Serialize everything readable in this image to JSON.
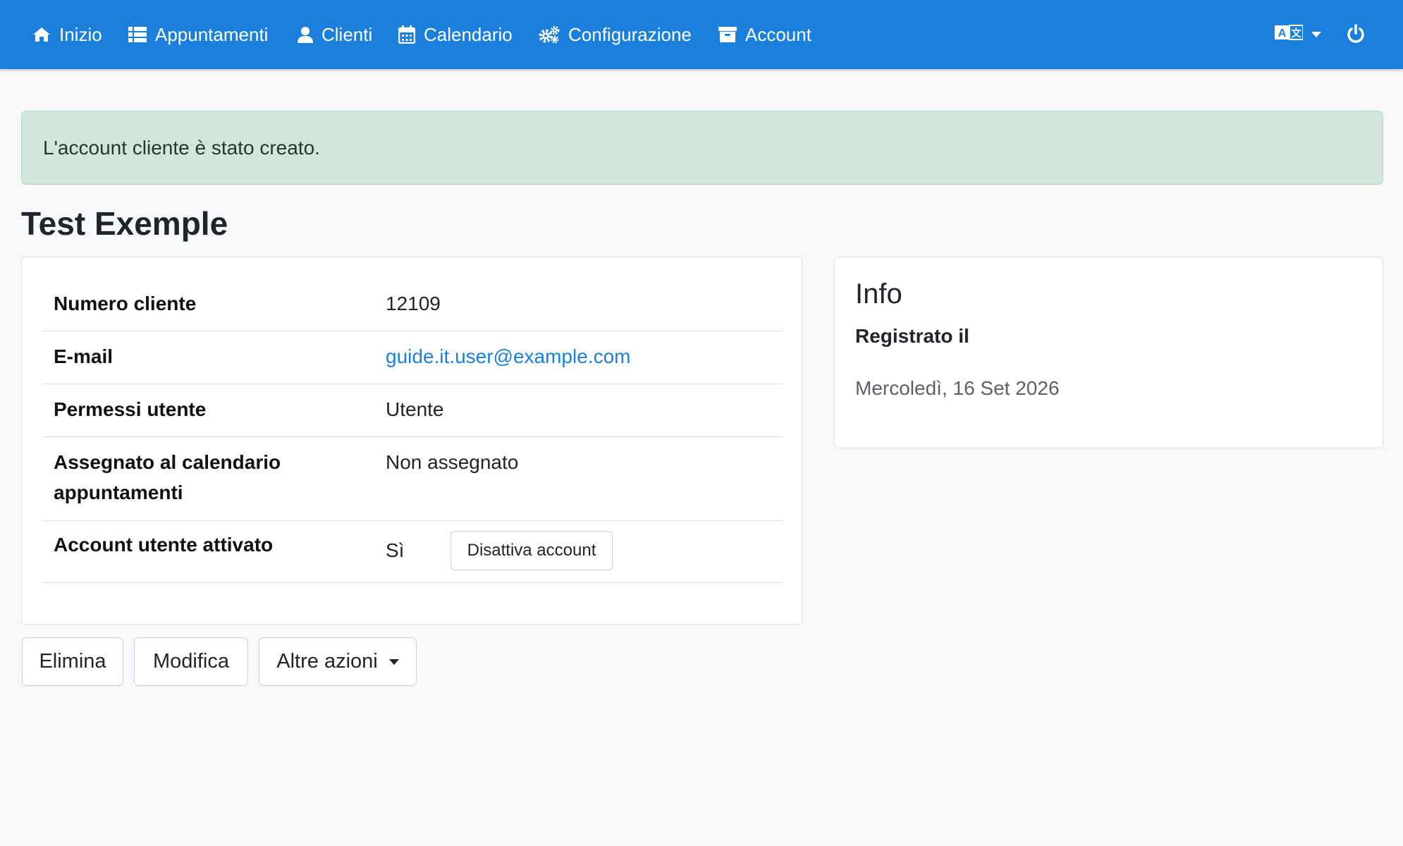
{
  "colors": {
    "navbar": "#1b80dc",
    "alert_background": "#d2e6dc",
    "link": "#1b80dc",
    "page_background": "#f7f8fa"
  },
  "navbar": {
    "items": [
      {
        "label": "Inizio",
        "icon": "home-icon"
      },
      {
        "label": "Appuntamenti",
        "icon": "list-icon"
      },
      {
        "label": "Clienti",
        "icon": "user-icon"
      },
      {
        "label": "Calendario",
        "icon": "calendar-icon"
      },
      {
        "label": "Configurazione",
        "icon": "cogs-icon"
      },
      {
        "label": "Account",
        "icon": "archive-icon"
      }
    ],
    "language_icon": "language-icon",
    "logout_icon": "power-icon"
  },
  "alert": {
    "message": "L'account cliente è stato creato."
  },
  "page": {
    "title": "Test Exemple"
  },
  "details": {
    "rows": [
      {
        "label": "Numero cliente",
        "value": "12109"
      },
      {
        "label": "E-mail",
        "value": "guide.it.user@example.com"
      },
      {
        "label": "Permessi utente",
        "value": "Utente"
      },
      {
        "label": "Assegnato al calendario appuntamenti",
        "value": "Non assegnato"
      },
      {
        "label": "Account utente attivato",
        "value": "Sì"
      }
    ],
    "deactivate_button": "Disattiva account"
  },
  "info": {
    "title": "Info",
    "registered_label": "Registrato il",
    "registered_value": "Mercoledì, 16 Set 2026"
  },
  "actions": {
    "delete": "Elimina",
    "edit": "Modifica",
    "more": "Altre azioni"
  }
}
